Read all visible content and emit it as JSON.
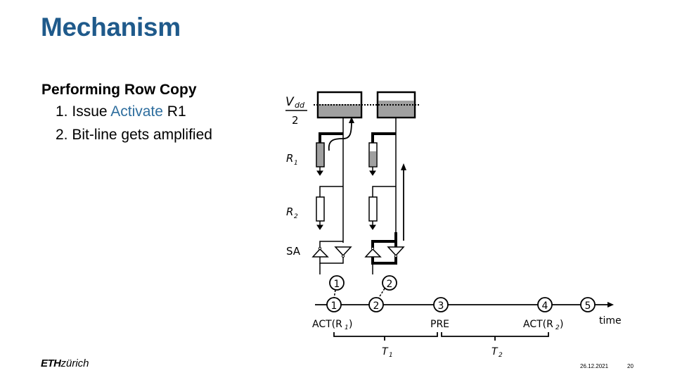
{
  "slide": {
    "title": "Mechanism",
    "heading": "Performing Row Copy",
    "steps": [
      {
        "number": "1.",
        "pre": "Issue ",
        "accent": "Activate",
        "post": " R1"
      },
      {
        "number": "2.",
        "pre": "Bit-line gets amplified",
        "accent": "",
        "post": ""
      }
    ],
    "accent_color": "#2e6e9e",
    "title_color": "#1f5a8b"
  },
  "diagram": {
    "vdd_label_top": "V",
    "vdd_label_sub": "dd",
    "vdd_label_bottom": "2",
    "row_labels": {
      "r1": "R",
      "r1_sub": "1",
      "r2": "R",
      "r2_sub": "2",
      "sa": "SA"
    },
    "stage_markers_upper": [
      "1",
      "2"
    ],
    "timeline": {
      "markers": [
        "1",
        "2",
        "3",
        "4",
        "5"
      ],
      "axis_label": "time",
      "event_labels": {
        "act_r1": "ACT(R",
        "act_r1_sub": "1",
        "pre": "PRE",
        "act_r2": "ACT(R",
        "act_r2_sub": "2",
        "close": ")"
      },
      "intervals": [
        {
          "label": "T",
          "sub": "1"
        },
        {
          "label": "T",
          "sub": "2"
        }
      ]
    }
  },
  "footer": {
    "logo_bold": "ETH",
    "logo_rest": "zürich",
    "date": "26.12.2021",
    "page": "20"
  }
}
